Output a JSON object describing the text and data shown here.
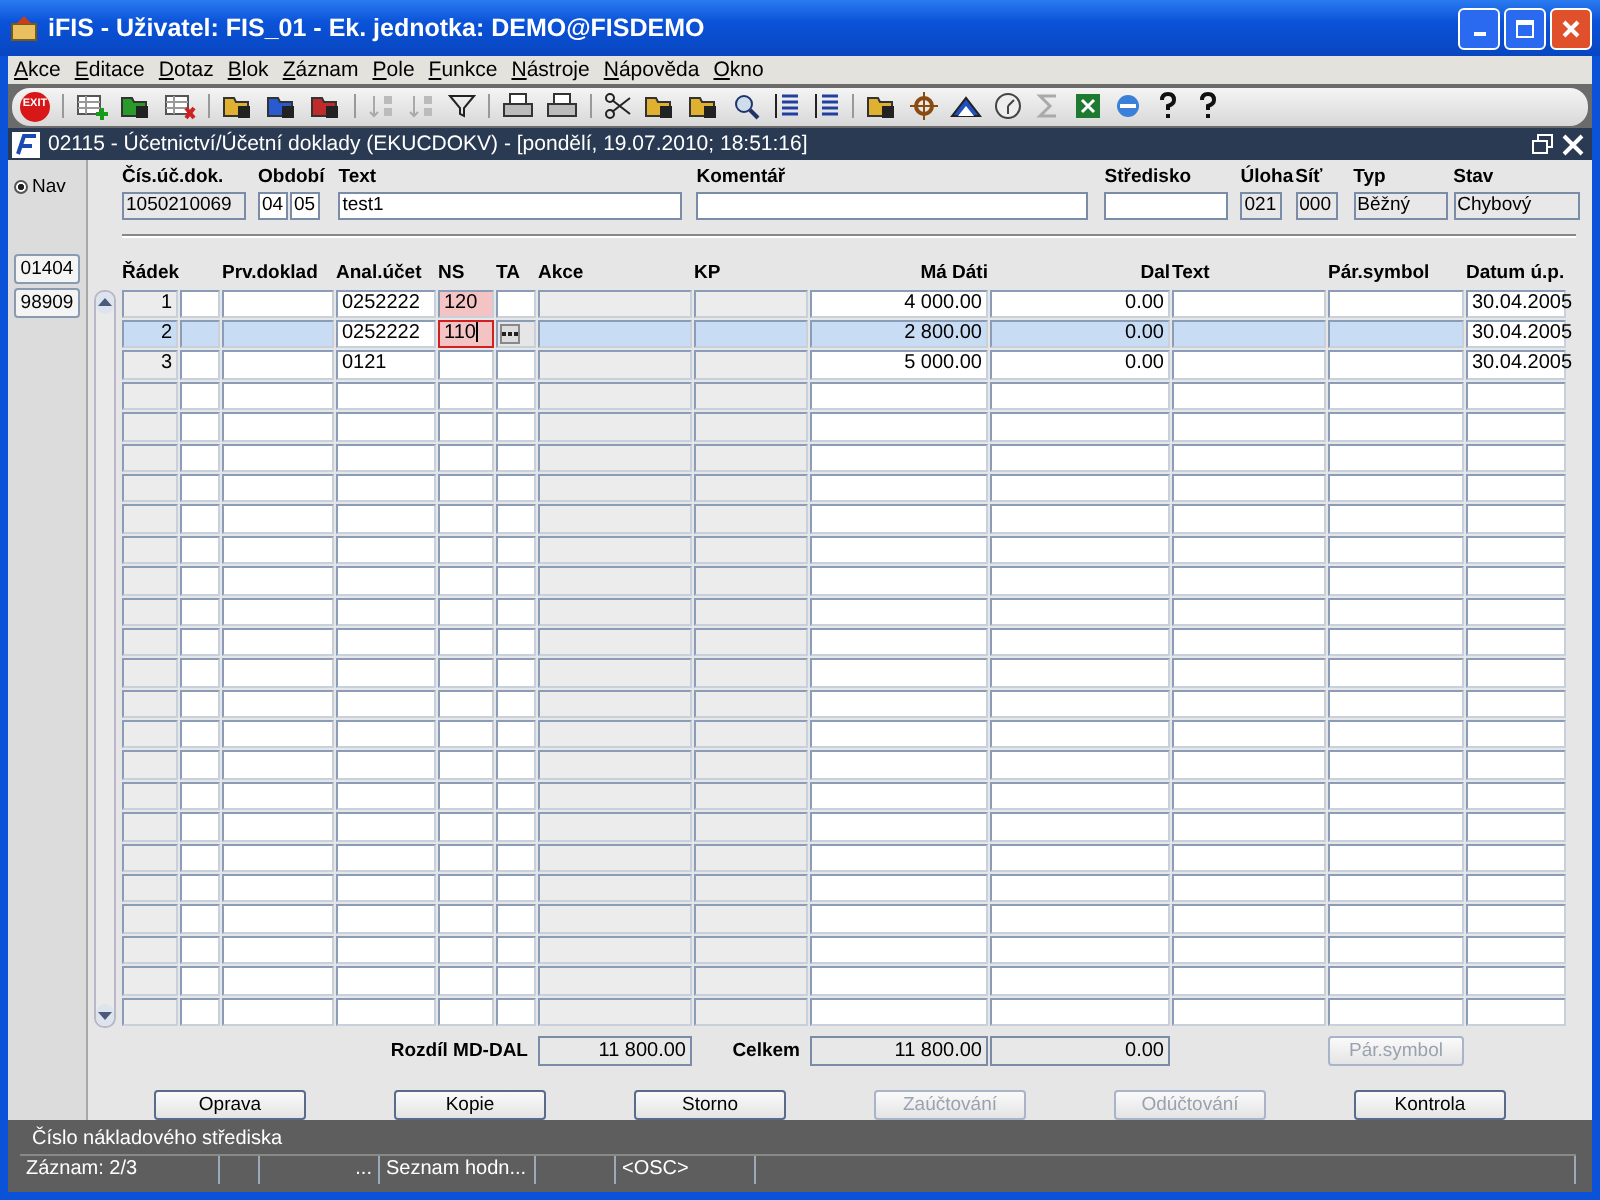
{
  "window": {
    "title": "iFIS - Uživatel: FIS_01 - Ek. jednotka: DEMO@FISDEMO"
  },
  "menu": [
    "Akce",
    "Editace",
    "Dotaz",
    "Blok",
    "Záznam",
    "Pole",
    "Funkce",
    "Nástroje",
    "Nápověda",
    "Okno"
  ],
  "toolbar": {
    "exit_label": "EXIT",
    "sort_disabled": true,
    "sum_disabled": true
  },
  "form": {
    "title": "02115 - Účetnictví/Účetní doklady (EKUCDOKV) - [pondělí, 19.07.2010; 18:51:16]"
  },
  "nav": {
    "label": "Nav",
    "selected": true
  },
  "side_buttons": [
    "01404",
    "98909"
  ],
  "header": [
    {
      "label": "Čís.úč.dok.",
      "fields": [
        {
          "value": "1050210069",
          "readonly": true
        }
      ]
    },
    {
      "label": "Období",
      "fields": [
        {
          "value": "04",
          "readonly": false
        },
        {
          "value": "05",
          "readonly": false
        }
      ]
    },
    {
      "label": "Text",
      "fields": [
        {
          "value": "test1",
          "readonly": false
        }
      ]
    },
    {
      "label": "Komentář",
      "fields": [
        {
          "readonly": false
        }
      ]
    },
    {
      "label": "Středisko",
      "fields": [
        {
          "readonly": false
        }
      ]
    },
    {
      "label": "Úloha",
      "fields": [
        {
          "value": "021",
          "readonly": true
        }
      ]
    },
    {
      "label": "Síť",
      "fields": [
        {
          "value": "000",
          "readonly": true
        }
      ]
    },
    {
      "label": "Typ",
      "fields": [
        {
          "value": "Běžný",
          "readonly": true
        }
      ]
    },
    {
      "label": "Stav",
      "fields": [
        {
          "value": "Chybový",
          "readonly": true
        }
      ]
    }
  ],
  "columns": [
    "Řádek",
    "Prv.doklad",
    "Anal.účet",
    "NS",
    "TA",
    "Akce",
    "KP",
    "Má Dáti",
    "Dal",
    "Text",
    "Pár.symbol",
    "Datum ú.p."
  ],
  "rows": [
    {
      "number": "1",
      "anal_ucet": "0252222",
      "ns": "120",
      "ma_dati": "4 000.00",
      "dal": "0.00",
      "datum": "30.04.2005",
      "selected": false,
      "ns_invalid": true
    },
    {
      "number": "2",
      "anal_ucet": "0252222",
      "ns": "110",
      "ma_dati": "2 800.00",
      "dal": "0.00",
      "datum": "30.04.2005",
      "selected": true,
      "ns_invalid": true
    },
    {
      "number": "3",
      "anal_ucet": "0121",
      "ma_dati": "5 000.00",
      "dal": "0.00",
      "datum": "30.04.2005",
      "selected": false,
      "ns_invalid": false
    }
  ],
  "totals": {
    "difference_label": "Rozdíl MD-DAL",
    "difference": "11 800.00",
    "total_label": "Celkem",
    "total_debit": "11 800.00",
    "total_credit": "0.00",
    "pair_button": {
      "label": "Pár.symbol",
      "disabled": true
    }
  },
  "buttons": [
    {
      "label": "Oprava",
      "disabled": false
    },
    {
      "label": "Kopie",
      "disabled": false
    },
    {
      "label": "Storno",
      "disabled": false
    },
    {
      "label": "Zaúčtování",
      "disabled": true
    },
    {
      "label": "Odúčtování",
      "disabled": true
    },
    {
      "label": "Kontrola",
      "disabled": false
    }
  ],
  "status": {
    "hint": "Číslo nákladového střediska",
    "record": "Záznam: 2/3",
    "segment_3": "...",
    "segment_4": "Seznam hodn...",
    "mode": "<OSC>"
  }
}
